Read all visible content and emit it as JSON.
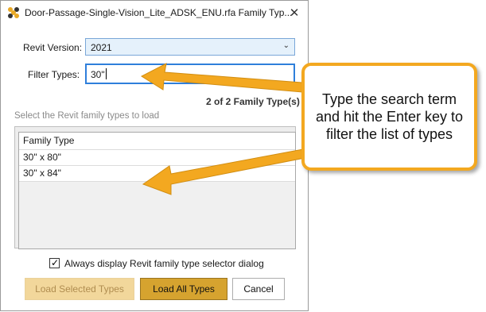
{
  "window": {
    "title": "Door-Passage-Single-Vision_Lite_ADSK_ENU.rfa Family Typ...",
    "close_glyph": "✕",
    "icon": "revit-family-icon"
  },
  "form": {
    "revit_version_label": "Revit Version:",
    "revit_version_value": "2021",
    "filter_types_label": "Filter Types:",
    "filter_value": "30\"",
    "count_text": "2 of 2 Family Type(s)",
    "section_label": "Select the Revit family types to load"
  },
  "table": {
    "header": "Family Type",
    "rows": [
      "30\" x 80\"",
      "30\" x 84\""
    ]
  },
  "options": {
    "always_display_label": "Always display Revit family type selector dialog",
    "always_display_checked": true
  },
  "buttons": {
    "load_selected": "Load Selected Types",
    "load_all": "Load All Types",
    "cancel": "Cancel"
  },
  "annotation": {
    "callout_text": "Type the search term and hit the Enter key to filter the list of types",
    "accent_color": "#f3a820"
  }
}
